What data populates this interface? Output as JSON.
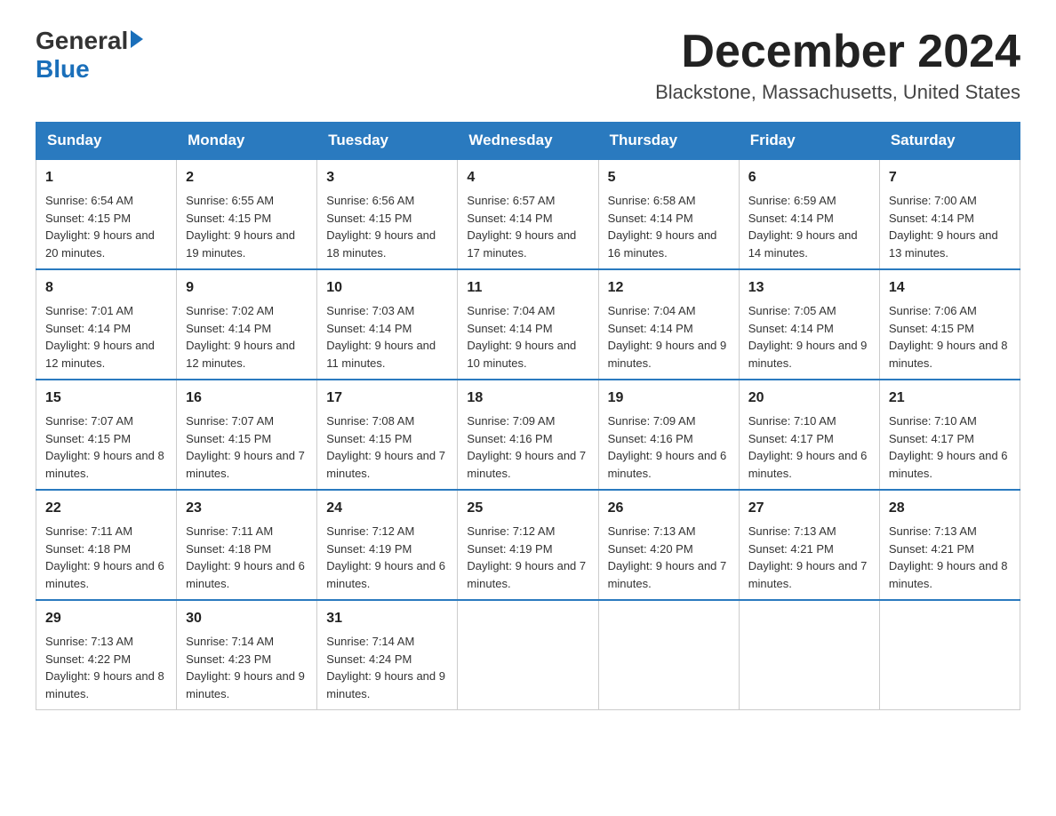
{
  "logo": {
    "general": "General",
    "blue": "Blue"
  },
  "title": "December 2024",
  "location": "Blackstone, Massachusetts, United States",
  "weekdays": [
    "Sunday",
    "Monday",
    "Tuesday",
    "Wednesday",
    "Thursday",
    "Friday",
    "Saturday"
  ],
  "weeks": [
    [
      {
        "day": "1",
        "sunrise": "6:54 AM",
        "sunset": "4:15 PM",
        "daylight": "9 hours and 20 minutes."
      },
      {
        "day": "2",
        "sunrise": "6:55 AM",
        "sunset": "4:15 PM",
        "daylight": "9 hours and 19 minutes."
      },
      {
        "day": "3",
        "sunrise": "6:56 AM",
        "sunset": "4:15 PM",
        "daylight": "9 hours and 18 minutes."
      },
      {
        "day": "4",
        "sunrise": "6:57 AM",
        "sunset": "4:14 PM",
        "daylight": "9 hours and 17 minutes."
      },
      {
        "day": "5",
        "sunrise": "6:58 AM",
        "sunset": "4:14 PM",
        "daylight": "9 hours and 16 minutes."
      },
      {
        "day": "6",
        "sunrise": "6:59 AM",
        "sunset": "4:14 PM",
        "daylight": "9 hours and 14 minutes."
      },
      {
        "day": "7",
        "sunrise": "7:00 AM",
        "sunset": "4:14 PM",
        "daylight": "9 hours and 13 minutes."
      }
    ],
    [
      {
        "day": "8",
        "sunrise": "7:01 AM",
        "sunset": "4:14 PM",
        "daylight": "9 hours and 12 minutes."
      },
      {
        "day": "9",
        "sunrise": "7:02 AM",
        "sunset": "4:14 PM",
        "daylight": "9 hours and 12 minutes."
      },
      {
        "day": "10",
        "sunrise": "7:03 AM",
        "sunset": "4:14 PM",
        "daylight": "9 hours and 11 minutes."
      },
      {
        "day": "11",
        "sunrise": "7:04 AM",
        "sunset": "4:14 PM",
        "daylight": "9 hours and 10 minutes."
      },
      {
        "day": "12",
        "sunrise": "7:04 AM",
        "sunset": "4:14 PM",
        "daylight": "9 hours and 9 minutes."
      },
      {
        "day": "13",
        "sunrise": "7:05 AM",
        "sunset": "4:14 PM",
        "daylight": "9 hours and 9 minutes."
      },
      {
        "day": "14",
        "sunrise": "7:06 AM",
        "sunset": "4:15 PM",
        "daylight": "9 hours and 8 minutes."
      }
    ],
    [
      {
        "day": "15",
        "sunrise": "7:07 AM",
        "sunset": "4:15 PM",
        "daylight": "9 hours and 8 minutes."
      },
      {
        "day": "16",
        "sunrise": "7:07 AM",
        "sunset": "4:15 PM",
        "daylight": "9 hours and 7 minutes."
      },
      {
        "day": "17",
        "sunrise": "7:08 AM",
        "sunset": "4:15 PM",
        "daylight": "9 hours and 7 minutes."
      },
      {
        "day": "18",
        "sunrise": "7:09 AM",
        "sunset": "4:16 PM",
        "daylight": "9 hours and 7 minutes."
      },
      {
        "day": "19",
        "sunrise": "7:09 AM",
        "sunset": "4:16 PM",
        "daylight": "9 hours and 6 minutes."
      },
      {
        "day": "20",
        "sunrise": "7:10 AM",
        "sunset": "4:17 PM",
        "daylight": "9 hours and 6 minutes."
      },
      {
        "day": "21",
        "sunrise": "7:10 AM",
        "sunset": "4:17 PM",
        "daylight": "9 hours and 6 minutes."
      }
    ],
    [
      {
        "day": "22",
        "sunrise": "7:11 AM",
        "sunset": "4:18 PM",
        "daylight": "9 hours and 6 minutes."
      },
      {
        "day": "23",
        "sunrise": "7:11 AM",
        "sunset": "4:18 PM",
        "daylight": "9 hours and 6 minutes."
      },
      {
        "day": "24",
        "sunrise": "7:12 AM",
        "sunset": "4:19 PM",
        "daylight": "9 hours and 6 minutes."
      },
      {
        "day": "25",
        "sunrise": "7:12 AM",
        "sunset": "4:19 PM",
        "daylight": "9 hours and 7 minutes."
      },
      {
        "day": "26",
        "sunrise": "7:13 AM",
        "sunset": "4:20 PM",
        "daylight": "9 hours and 7 minutes."
      },
      {
        "day": "27",
        "sunrise": "7:13 AM",
        "sunset": "4:21 PM",
        "daylight": "9 hours and 7 minutes."
      },
      {
        "day": "28",
        "sunrise": "7:13 AM",
        "sunset": "4:21 PM",
        "daylight": "9 hours and 8 minutes."
      }
    ],
    [
      {
        "day": "29",
        "sunrise": "7:13 AM",
        "sunset": "4:22 PM",
        "daylight": "9 hours and 8 minutes."
      },
      {
        "day": "30",
        "sunrise": "7:14 AM",
        "sunset": "4:23 PM",
        "daylight": "9 hours and 9 minutes."
      },
      {
        "day": "31",
        "sunrise": "7:14 AM",
        "sunset": "4:24 PM",
        "daylight": "9 hours and 9 minutes."
      },
      null,
      null,
      null,
      null
    ]
  ],
  "labels": {
    "sunrise": "Sunrise:",
    "sunset": "Sunset:",
    "daylight": "Daylight:"
  }
}
